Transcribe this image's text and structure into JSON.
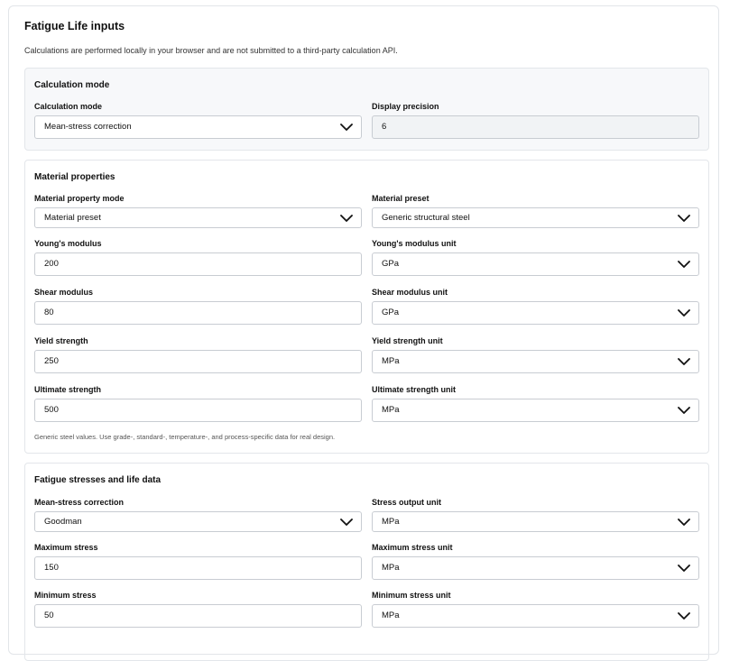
{
  "panel": {
    "title": "Fatigue Life inputs",
    "note": "Calculations are performed locally in your browser and are not submitted to a third-party calculation API."
  },
  "calc_mode": {
    "section_title": "Calculation mode",
    "mode": {
      "label": "Calculation mode",
      "value": "Mean-stress correction"
    },
    "precision": {
      "label": "Display precision",
      "value": "6"
    }
  },
  "material": {
    "section_title": "Material properties",
    "property_mode": {
      "label": "Material property mode",
      "value": "Material preset"
    },
    "preset": {
      "label": "Material preset",
      "value": "Generic structural steel"
    },
    "youngs_modulus": {
      "label": "Young's modulus",
      "value": "200"
    },
    "youngs_modulus_unit": {
      "label": "Young's modulus unit",
      "value": "GPa"
    },
    "shear_modulus": {
      "label": "Shear modulus",
      "value": "80"
    },
    "shear_modulus_unit": {
      "label": "Shear modulus unit",
      "value": "GPa"
    },
    "yield_strength": {
      "label": "Yield strength",
      "value": "250"
    },
    "yield_strength_unit": {
      "label": "Yield strength unit",
      "value": "MPa"
    },
    "ultimate_strength": {
      "label": "Ultimate strength",
      "value": "500"
    },
    "ultimate_strength_unit": {
      "label": "Ultimate strength unit",
      "value": "MPa"
    },
    "hint": "Generic steel values. Use grade-, standard-, temperature-, and process-specific data for real design."
  },
  "fatigue": {
    "section_title": "Fatigue stresses and life data",
    "mean_stress_correction": {
      "label": "Mean-stress correction",
      "value": "Goodman"
    },
    "stress_output_unit": {
      "label": "Stress output unit",
      "value": "MPa"
    },
    "maximum_stress": {
      "label": "Maximum stress",
      "value": "150"
    },
    "maximum_stress_unit": {
      "label": "Maximum stress unit",
      "value": "MPa"
    },
    "minimum_stress": {
      "label": "Minimum stress",
      "value": "50"
    },
    "minimum_stress_unit": {
      "label": "Minimum stress unit",
      "value": "MPa"
    }
  },
  "icons": {
    "dropdown": "chevron-down-icon"
  }
}
